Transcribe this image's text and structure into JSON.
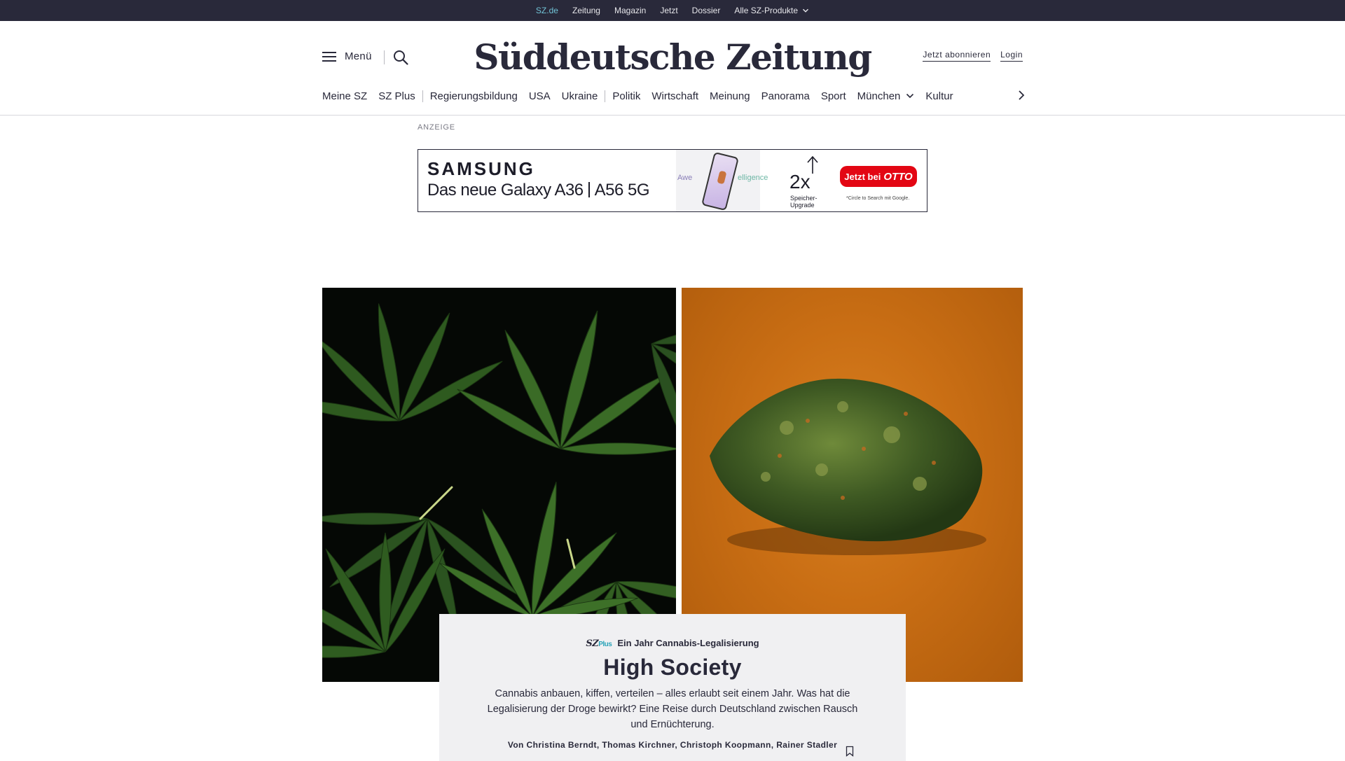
{
  "topbar": {
    "links": [
      {
        "label": "SZ.de",
        "active": true
      },
      {
        "label": "Zeitung"
      },
      {
        "label": "Magazin"
      },
      {
        "label": "Jetzt"
      },
      {
        "label": "Dossier"
      },
      {
        "label": "Alle SZ-Produkte",
        "dropdown": true
      }
    ]
  },
  "header": {
    "menu_label": "Menü",
    "logo_text": "Süddeutsche Zeitung",
    "subscribe_label": "Jetzt abonnieren",
    "login_label": "Login"
  },
  "nav": {
    "items": [
      "Meine SZ",
      "SZ Plus",
      "Regierungsbildung",
      "USA",
      "Ukraine",
      "Politik",
      "Wirtschaft",
      "Meinung",
      "Panorama",
      "Sport",
      "München",
      "Kultur"
    ]
  },
  "ad": {
    "label": "ANZEIGE",
    "brand": "SAMSUNG",
    "headline_part1": "Das neue Galaxy A36",
    "headline_part2": "A56 5G",
    "faded_left": "Awe",
    "faded_right": "elligence",
    "upgrade_big": "2x",
    "upgrade_text": "Speicher-Upgrade",
    "cta_prefix": "Jetzt bei",
    "cta_brand": "OTTO",
    "footnote": "*Circle to Search mit Google."
  },
  "article": {
    "badge_sz": "SZ",
    "badge_plus": "Plus",
    "kicker": "Ein Jahr Cannabis-Legalisierung",
    "title": "High Society",
    "teaser": "Cannabis anbauen, kiffen, verteilen – alles erlaubt seit einem Jahr. Was hat die Legalisierung der Droge bewirkt? Eine Reise durch Deutschland zwischen Rausch und Ernüchterung.",
    "byline": "Von Christina Berndt, Thomas Kirchner, Christoph Koopmann, Rainer Stadler"
  },
  "colors": {
    "brand_dark": "#29293a",
    "topbar_active": "#71c3d6",
    "plus_accent": "#2aa3b8",
    "otto_red": "#e30613"
  }
}
